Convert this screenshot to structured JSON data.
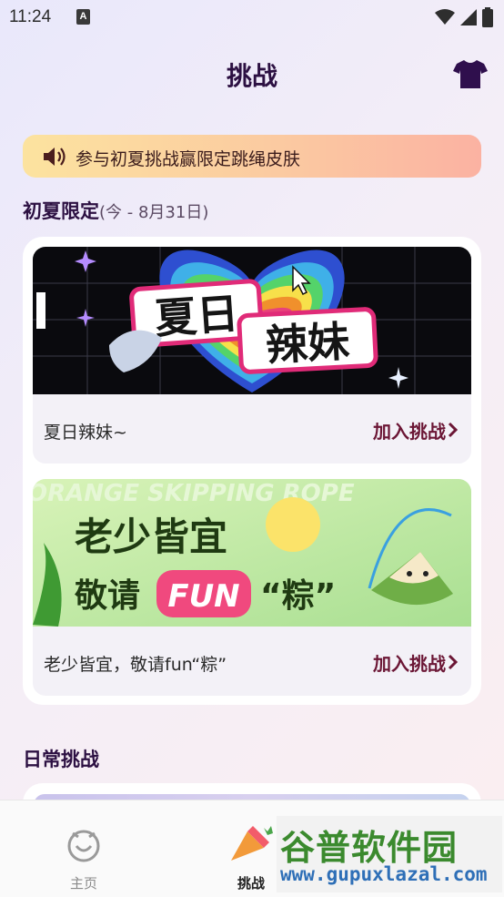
{
  "status_bar": {
    "time": "11:24",
    "sim_label": "A"
  },
  "header": {
    "title": "挑战",
    "shirt_icon": "t-shirt-icon"
  },
  "notice": {
    "text": "参与初夏挑战赢限定跳绳皮肤",
    "icon": "speaker-icon"
  },
  "section_limited": {
    "title": "初夏限定",
    "range": "(今 - 8月31日)"
  },
  "cards": [
    {
      "name": "夏日辣妹~",
      "join_label": "加入挑战",
      "banner_text": "夏日辣妹"
    },
    {
      "name": "老少皆宜，敬请fun“粽”",
      "join_label": "加入挑战",
      "banner_line1": "老少皆宜",
      "banner_line2_a": "敬请",
      "banner_line2_b": "FUN",
      "banner_line2_c": "“粽”",
      "banner_bg_text": "ORANGE SKIPPING ROPE"
    }
  ],
  "section_daily": {
    "title": "日常挑战"
  },
  "bottom_nav": [
    {
      "label": "主页",
      "icon": "home-face-icon",
      "active": false
    },
    {
      "label": "挑战",
      "icon": "challenge-trumpet-icon",
      "active": true
    }
  ],
  "watermark": {
    "title": "谷普软件园",
    "url": "www.gupuxlazal.com"
  },
  "colors": {
    "accent": "#6b1635",
    "title": "#2c1042",
    "notice_start": "#fce39f",
    "notice_end": "#fbb2a2"
  }
}
